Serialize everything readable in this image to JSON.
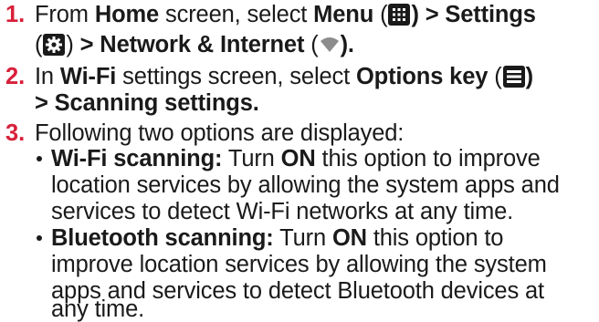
{
  "steps": [
    {
      "number": "1.",
      "lines": [
        {
          "t1": "From ",
          "b1": "Home",
          "t2": " screen, select ",
          "b2": "Menu",
          "t3": " (",
          "b3": ") > Settings"
        },
        {
          "t1": "(",
          "t2": ") ",
          "b1": "> Network & Internet",
          "t3": " (",
          "b2": ")."
        }
      ]
    },
    {
      "number": "2.",
      "lines": [
        {
          "t1": "In ",
          "b1": "Wi-Fi",
          "t2": " settings screen, select ",
          "b2": "Options key",
          "t3": " (",
          "b3": ")"
        },
        {
          "b1": "> Scanning settings."
        }
      ]
    },
    {
      "number": "3.",
      "lines": [
        {
          "t1": "Following two options are displayed:"
        }
      ]
    }
  ],
  "options": [
    {
      "lines": [
        {
          "b1": "Wi-Fi scanning:",
          "t1": " Turn ",
          "b2": "ON",
          "t2": " this option to improve"
        },
        {
          "t1": "location services by allowing the system apps and"
        },
        {
          "t1": "services to detect Wi-Fi networks at any time."
        }
      ]
    },
    {
      "lines": [
        {
          "b1": "Bluetooth scanning:",
          "t1": " Turn ",
          "b2": "ON",
          "t2": " this option to"
        },
        {
          "t1": "improve location services by allowing the system"
        },
        {
          "t1": "apps and services to detect Bluetooth devices at"
        },
        {
          "t1": "any time."
        }
      ]
    }
  ],
  "icons": {
    "menu": "grid-menu-icon",
    "settings": "gear-icon",
    "network": "wifi-icon",
    "options": "options-key-icon"
  },
  "colors": {
    "step_number": "#d8203a",
    "icon_bg": "#1a1a1a"
  }
}
